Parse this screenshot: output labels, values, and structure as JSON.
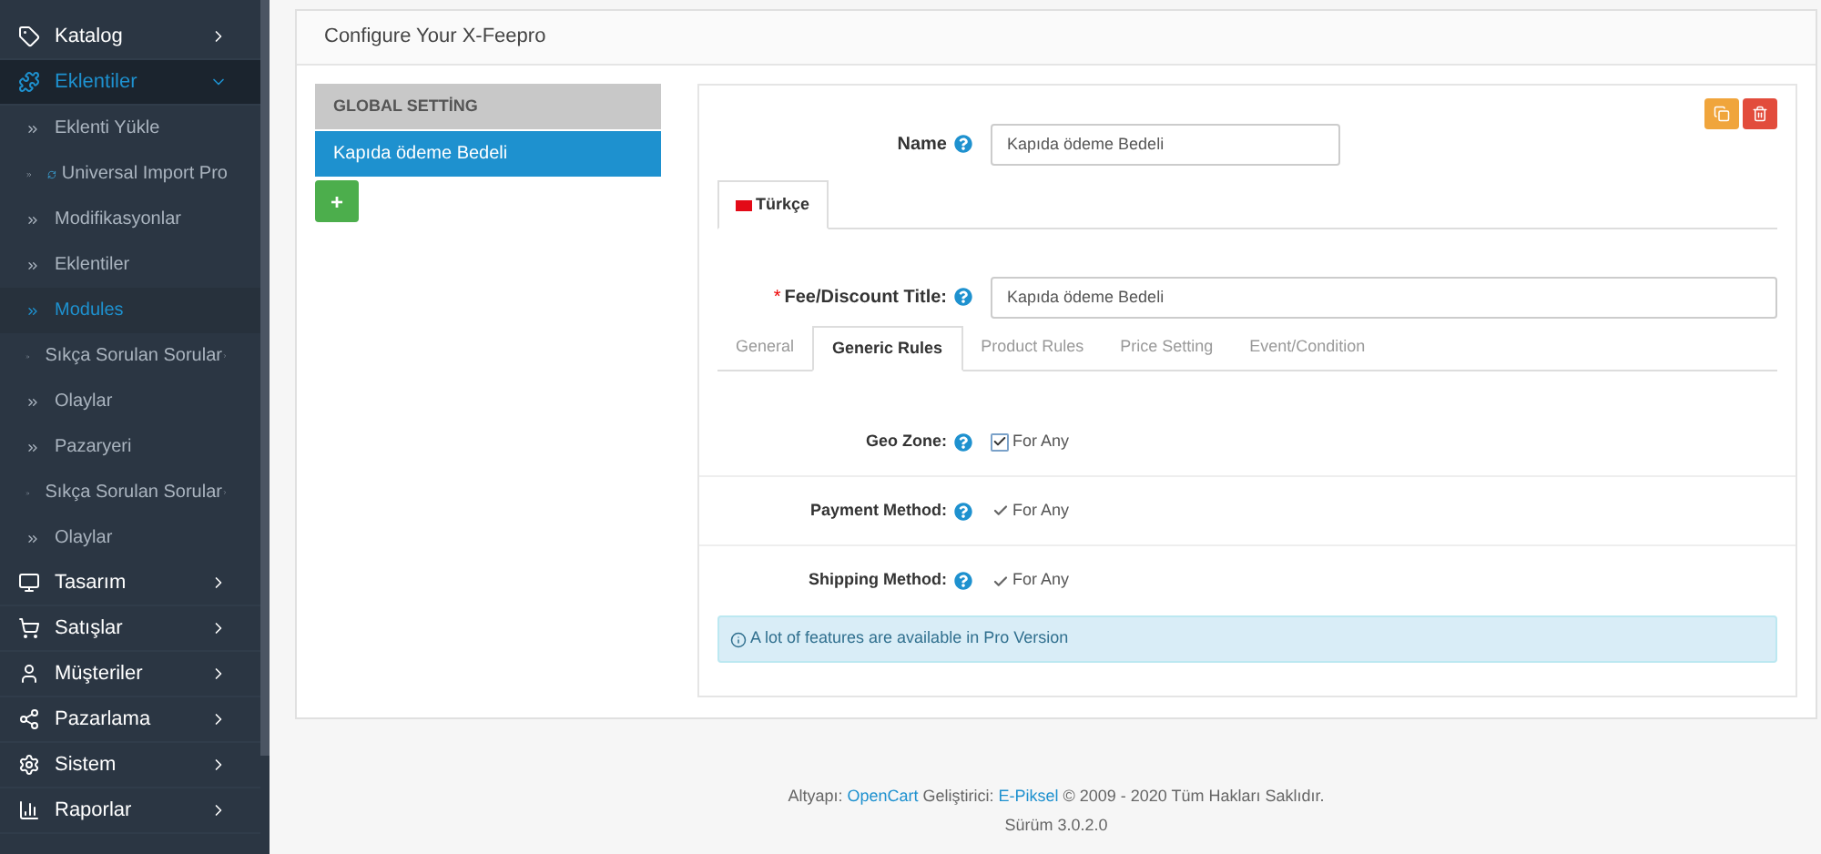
{
  "sidebar": {
    "items": [
      {
        "label": "Katalog",
        "selected": false,
        "expanded": false
      },
      {
        "label": "Eklentiler",
        "selected": true,
        "expanded": true,
        "children": [
          {
            "label": "Eklenti Yükle",
            "selected": false,
            "has_submenu": false
          },
          {
            "label": "Universal Import Pro",
            "selected": false,
            "has_submenu": false,
            "kind": "with-icon"
          },
          {
            "label": "Modifikasyonlar",
            "selected": false,
            "has_submenu": false
          },
          {
            "label": "Eklentiler",
            "selected": false,
            "has_submenu": false
          },
          {
            "label": "Modules",
            "selected": true,
            "has_submenu": false
          },
          {
            "label": "Sıkça Sorulan Sorular",
            "selected": false,
            "has_submenu": true
          },
          {
            "label": "Olaylar",
            "selected": false,
            "has_submenu": false
          },
          {
            "label": "Pazaryeri",
            "selected": false,
            "has_submenu": false
          },
          {
            "label": "Sıkça Sorulan Sorular",
            "selected": false,
            "has_submenu": true
          },
          {
            "label": "Olaylar",
            "selected": false,
            "has_submenu": false
          }
        ]
      },
      {
        "label": "Tasarım",
        "selected": false,
        "expanded": false
      },
      {
        "label": "Satışlar",
        "selected": false,
        "expanded": false
      },
      {
        "label": "Müşteriler",
        "selected": false,
        "expanded": false
      },
      {
        "label": "Pazarlama",
        "selected": false,
        "expanded": false
      },
      {
        "label": "Sistem",
        "selected": false,
        "expanded": false
      },
      {
        "label": "Raporlar",
        "selected": false,
        "expanded": false
      }
    ]
  },
  "panel": {
    "title": "Configure Your X-Feepro",
    "fee_list": [
      {
        "label": "GLOBAL SETTİNG",
        "kind": "header",
        "selected": false
      },
      {
        "label": "Kapıda ödeme Bedeli",
        "kind": "item",
        "selected": true
      }
    ],
    "add_button": "+",
    "form": {
      "name_label": "Name",
      "name_value": "Kapıda ödeme Bedeli",
      "language_tabs": [
        {
          "label": "Türkçe",
          "selected": true
        }
      ],
      "title_label": "Fee/Discount Title:",
      "title_required_mark": "*",
      "title_value": "Kapıda ödeme Bedeli",
      "tabs": [
        {
          "label": "General",
          "selected": false
        },
        {
          "label": "Generic Rules",
          "selected": true
        },
        {
          "label": "Product Rules",
          "selected": false
        },
        {
          "label": "Price Setting",
          "selected": false
        },
        {
          "label": "Event/Condition",
          "selected": false
        }
      ],
      "rules": [
        {
          "label": "Geo Zone:",
          "option": "For Any",
          "checked": true,
          "disabled": false
        },
        {
          "label": "Payment Method:",
          "option": "For Any",
          "checked": true,
          "disabled": true
        },
        {
          "label": "Shipping Method:",
          "option": "For Any",
          "checked": true,
          "disabled": true
        }
      ],
      "alert": "A lot of features are available in Pro Version"
    }
  },
  "footer": {
    "parts": [
      {
        "text": "Altyapı: ",
        "kind": "text"
      },
      {
        "text": "OpenCart",
        "kind": "link"
      },
      {
        "text": " Geliştirici: ",
        "kind": "text"
      },
      {
        "text": "E-Piksel",
        "kind": "link"
      },
      {
        "text": " © 2009 - 2020 Tüm Hakları Saklıdır.",
        "kind": "text"
      }
    ],
    "version": "Sürüm 3.0.2.0"
  }
}
